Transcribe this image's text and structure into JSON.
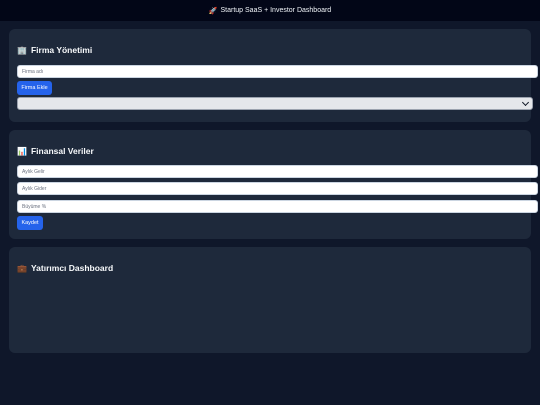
{
  "header": {
    "icon": "rocket-icon",
    "emoji": "🚀",
    "title": "Startup SaaS + Investor Dashboard"
  },
  "firma": {
    "icon": "building-icon",
    "emoji": "🏢",
    "title": "Firma Yönetimi",
    "name_placeholder": "Firma adı",
    "add_button": "Firma Ekle",
    "select_value": ""
  },
  "finans": {
    "icon": "chart-icon",
    "emoji": "📊",
    "title": "Finansal Veriler",
    "revenue_placeholder": "Aylık Gelir",
    "expense_placeholder": "Aylık Gider",
    "growth_placeholder": "Büyüme %",
    "save_button": "Kaydet"
  },
  "investor": {
    "icon": "briefcase-icon",
    "emoji": "💼",
    "title": "Yatırımcı Dashboard"
  }
}
